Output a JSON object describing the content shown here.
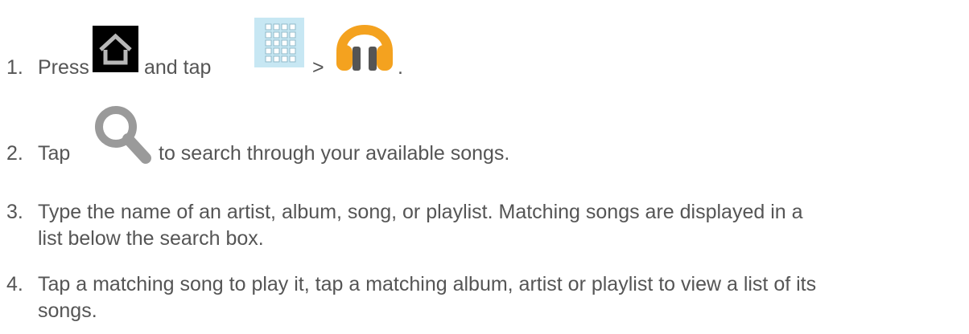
{
  "steps": [
    {
      "num": "1.",
      "text_a": "Press",
      "text_b": "and tap",
      "text_c": ">",
      "text_d": ".",
      "icons": [
        "home-icon",
        "app-grid-icon",
        "headphones-icon"
      ]
    },
    {
      "num": "2.",
      "text_a": "Tap",
      "text_b": "to search through your available songs.",
      "icons": [
        "search-icon"
      ]
    },
    {
      "num": "3.",
      "line1": "Type the name of an artist, album, song, or playlist. Matching songs are displayed in a",
      "line2": "list below the search box."
    },
    {
      "num": "4.",
      "line1": "Tap a matching song to play it, tap a matching album, artist or playlist to view a list of its",
      "line2": "songs."
    }
  ],
  "colors": {
    "text": "#555555",
    "accent_orange": "#f4a21f",
    "grid_bg": "#c7e7f3"
  }
}
